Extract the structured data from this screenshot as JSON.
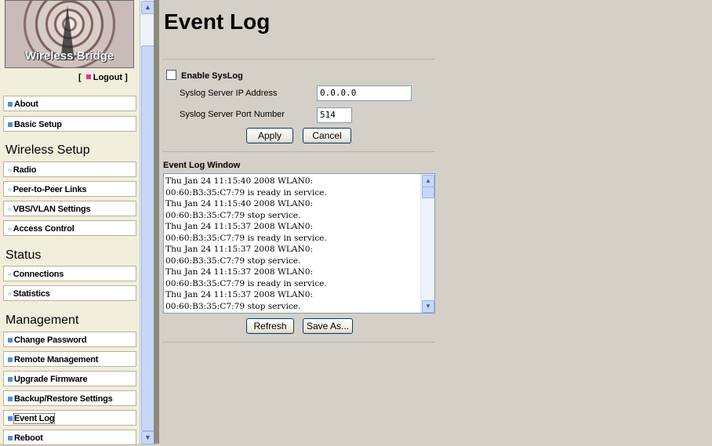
{
  "sidebar": {
    "logo_text": "Wireless Bridge",
    "logout": {
      "open": "[",
      "label": "Logout",
      "close": "]"
    },
    "items_top": [
      {
        "label": "About"
      },
      {
        "label": "Basic Setup"
      }
    ],
    "sections": [
      {
        "title": "Wireless Setup",
        "items": [
          {
            "label": "Radio"
          },
          {
            "label": "Peer-to-Peer Links"
          },
          {
            "label": "VBS/VLAN Settings"
          },
          {
            "label": "Access Control"
          }
        ]
      },
      {
        "title": "Status",
        "items": [
          {
            "label": "Connections"
          },
          {
            "label": "Statistics"
          }
        ]
      },
      {
        "title": "Management",
        "items": [
          {
            "label": "Change Password"
          },
          {
            "label": "Remote Management"
          },
          {
            "label": "Upgrade Firmware"
          },
          {
            "label": "Backup/Restore Settings"
          },
          {
            "label": "Event Log"
          },
          {
            "label": "Reboot"
          }
        ]
      }
    ],
    "active_item": "Event Log"
  },
  "main": {
    "title": "Event Log",
    "syslog": {
      "enable_label": "Enable SysLog",
      "enabled": false,
      "ip_label": "Syslog Server IP Address",
      "ip_value": "0.0.0.0",
      "port_label": "Syslog Server Port Number",
      "port_value": "514",
      "apply_label": "Apply",
      "cancel_label": "Cancel"
    },
    "event_log": {
      "title": "Event Log Window",
      "lines": [
        "Thu Jan 24 11:15:40 2008 WLAN0:",
        "00:60:B3:35:C7:79 is ready in service.",
        "Thu Jan 24 11:15:40 2008 WLAN0:",
        "00:60:B3:35:C7:79 stop service.",
        "Thu Jan 24 11:15:37 2008 WLAN0:",
        "00:60:B3:35:C7:79 is ready in service.",
        "Thu Jan 24 11:15:37 2008 WLAN0:",
        "00:60:B3:35:C7:79 stop service.",
        "Thu Jan 24 11:15:37 2008 WLAN0:",
        "00:60:B3:35:C7:79 is ready in service.",
        "Thu Jan 24 11:15:37 2008 WLAN0:",
        "00:60:B3:35:C7:79 stop service."
      ],
      "refresh_label": "Refresh",
      "save_as_label": "Save As..."
    }
  },
  "colors": {
    "page_background": "#d4d0c8",
    "sidebar_background": "#f2eedc",
    "nav_bullet": "#4c8de0",
    "logout_bullet": "#e4328c"
  },
  "icons": {
    "nav_bullet": "square-bullet-icon",
    "nav_wireless": "wireless-signal-icon",
    "scroll_up": "scroll-up-arrow-icon",
    "scroll_down": "scroll-down-arrow-icon"
  }
}
